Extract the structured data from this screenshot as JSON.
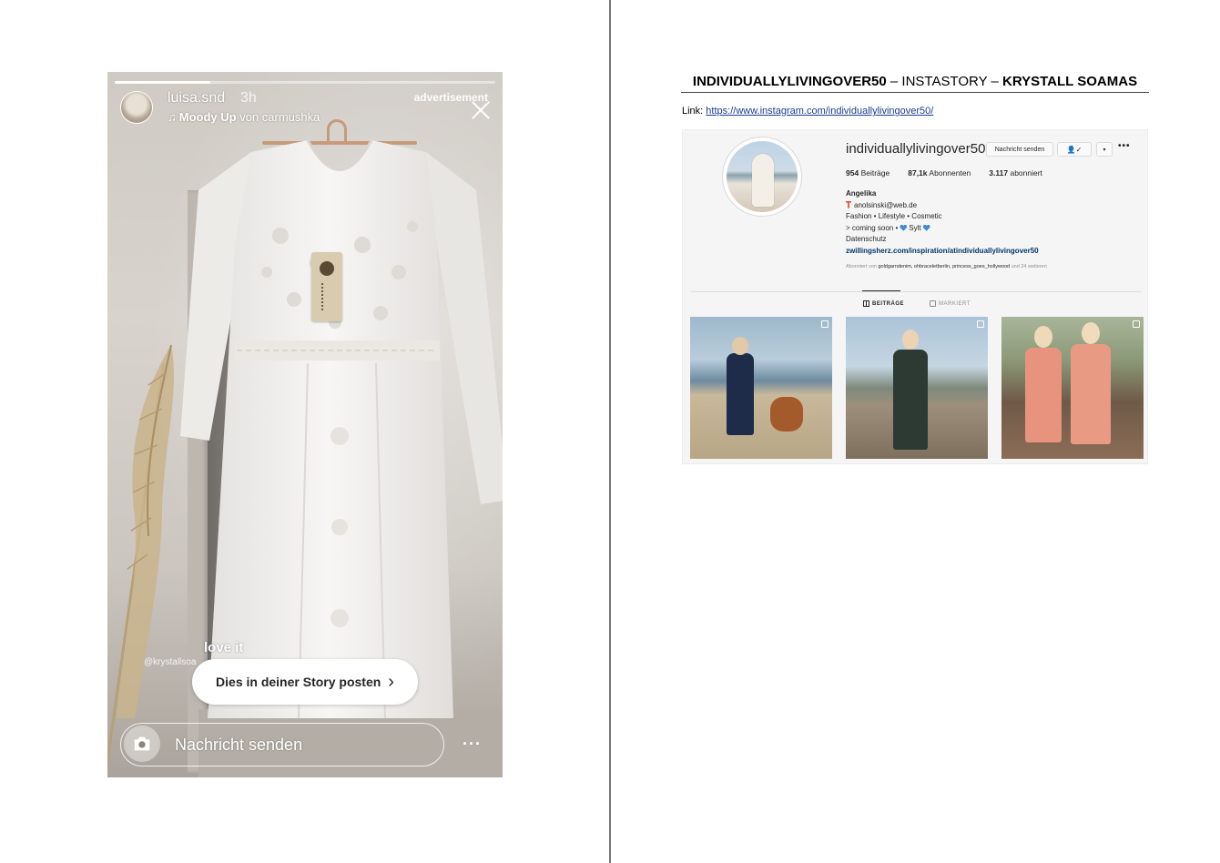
{
  "story": {
    "username": "luisa.snd",
    "time": "3h",
    "music_title": "Moody Up",
    "music_artist": "von carmushka",
    "ad_label": "advertisement",
    "caption": "love it",
    "mention": "@krystallsoa",
    "share_button": "Dies in deiner Story posten",
    "message_placeholder": "Nachricht senden",
    "progress": 0.25,
    "icons": [
      "avatar",
      "music-note-icon",
      "close-icon",
      "chevron-right-icon",
      "camera-icon",
      "more-icon"
    ]
  },
  "document": {
    "title_account": "INDIVIDUALLYLIVINGOVER50",
    "title_sep1": " – INSTASTORY – ",
    "title_person": "KRYSTALL SOAMAS",
    "link_label": "Link: ",
    "link_url": "https://www.instagram.com/individuallylivingover50/"
  },
  "profile": {
    "handle": "individuallylivingover50",
    "message_button": "Nachricht senden",
    "follow_button": "👤✓",
    "dropdown_button": "▾",
    "more": "•••",
    "stats": {
      "posts_value": "954",
      "posts_label": "Beiträge",
      "followers_value": "87,1k",
      "followers_label": "Abonnenten",
      "following_value": "3.117",
      "following_label": "abonniert"
    },
    "bio": {
      "name": "Angelika",
      "email": "anolsinski@web.de",
      "line2": "Fashion • Lifestyle • Cosmetic",
      "line3_pre": "> coming soon •",
      "line3_post": "Sylt",
      "line4": "Datenschutz",
      "link": "zwillingsherz.com/inspiration/atindividuallylivingover50"
    },
    "followed_by_prefix": "Abonniert von ",
    "followed_by_names": "goldgarndenim, ohbraceletberlin, princess_goes_hollywood",
    "followed_by_suffix": " und 24 weiteren",
    "tabs": {
      "posts": "BEITRÄGE",
      "tagged": "MARKIERT"
    }
  },
  "colors": {
    "link_blue": "#1a3d8f",
    "ig_link": "#00376b",
    "heart_blue": "#3e8ad6"
  }
}
